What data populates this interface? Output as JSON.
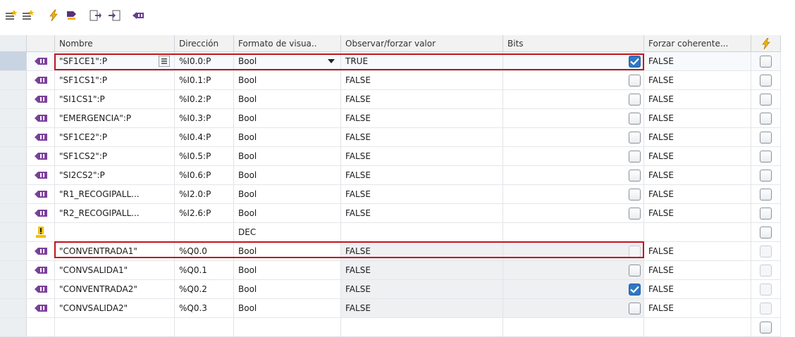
{
  "toolbar": {
    "buttons": [
      {
        "name": "insert-row-icon"
      },
      {
        "name": "add-row-icon"
      },
      {
        "name": "force-icon"
      },
      {
        "name": "modify-icon"
      },
      {
        "name": "export-icon"
      },
      {
        "name": "import-icon"
      },
      {
        "name": "monitor-icon"
      }
    ]
  },
  "header": {
    "name": "Nombre",
    "address": "Dirección",
    "format": "Formato de visua..",
    "observe": "Observar/forzar valor",
    "bits": "Bits",
    "force": "Forzar coherente...",
    "coherent_icon": "lightning-icon"
  },
  "rows": [
    {
      "name": "\"SF1CE1\":P",
      "address": "%I0.0:P",
      "format": "Bool",
      "observe": "TRUE",
      "bit_checked": true,
      "force": "FALSE",
      "type": "tag",
      "selected": true
    },
    {
      "name": "\"SF1CS1\":P",
      "address": "%I0.1:P",
      "format": "Bool",
      "observe": "FALSE",
      "bit_checked": false,
      "force": "FALSE",
      "type": "tag"
    },
    {
      "name": "\"SI1CS1\":P",
      "address": "%I0.2:P",
      "format": "Bool",
      "observe": "FALSE",
      "bit_checked": false,
      "force": "FALSE",
      "type": "tag"
    },
    {
      "name": "\"EMERGENCIA\":P",
      "address": "%I0.3:P",
      "format": "Bool",
      "observe": "FALSE",
      "bit_checked": false,
      "force": "FALSE",
      "type": "tag"
    },
    {
      "name": "\"SF1CE2\":P",
      "address": "%I0.4:P",
      "format": "Bool",
      "observe": "FALSE",
      "bit_checked": false,
      "force": "FALSE",
      "type": "tag"
    },
    {
      "name": "\"SF1CS2\":P",
      "address": "%I0.5:P",
      "format": "Bool",
      "observe": "FALSE",
      "bit_checked": false,
      "force": "FALSE",
      "type": "tag"
    },
    {
      "name": "\"SI2CS2\":P",
      "address": "%I0.6:P",
      "format": "Bool",
      "observe": "FALSE",
      "bit_checked": false,
      "force": "FALSE",
      "type": "tag"
    },
    {
      "name": "\"R1_RECOGIPALL...",
      "address": "%I2.0:P",
      "format": "Bool",
      "observe": "FALSE",
      "bit_checked": false,
      "force": "FALSE",
      "type": "tag"
    },
    {
      "name": "\"R2_RECOGIPALL...",
      "address": "%I2.6:P",
      "format": "Bool",
      "observe": "FALSE",
      "bit_checked": false,
      "force": "FALSE",
      "type": "tag"
    },
    {
      "name": "",
      "address": "",
      "format": "DEC",
      "observe": "",
      "bit_checked": null,
      "force": "",
      "type": "warning"
    },
    {
      "name": "\"CONVENTRADA1\"",
      "address": "%Q0.0",
      "format": "Bool",
      "observe": "FALSE",
      "bit_checked": false,
      "force": "FALSE",
      "type": "tag",
      "highlighted": true,
      "faint": true
    },
    {
      "name": "\"CONVSALIDA1\"",
      "address": "%Q0.1",
      "format": "Bool",
      "observe": "FALSE",
      "bit_checked": false,
      "force": "FALSE",
      "type": "tag",
      "faint": true
    },
    {
      "name": "\"CONVENTRADA2\"",
      "address": "%Q0.2",
      "format": "Bool",
      "observe": "FALSE",
      "bit_checked": true,
      "force": "FALSE",
      "type": "tag",
      "faint": true
    },
    {
      "name": "\"CONVSALIDA2\"",
      "address": "%Q0.3",
      "format": "Bool",
      "observe": "FALSE",
      "bit_checked": false,
      "force": "FALSE",
      "type": "tag",
      "faint": true
    },
    {
      "name": "",
      "address": "",
      "format": "",
      "observe": "",
      "bit_checked": null,
      "force": "",
      "type": "empty"
    }
  ],
  "colors": {
    "highlight_border": "#c0141c",
    "checkbox_checked": "#2f78c4",
    "tag_icon": "#7a3f9a",
    "warning": "#f2c200"
  }
}
